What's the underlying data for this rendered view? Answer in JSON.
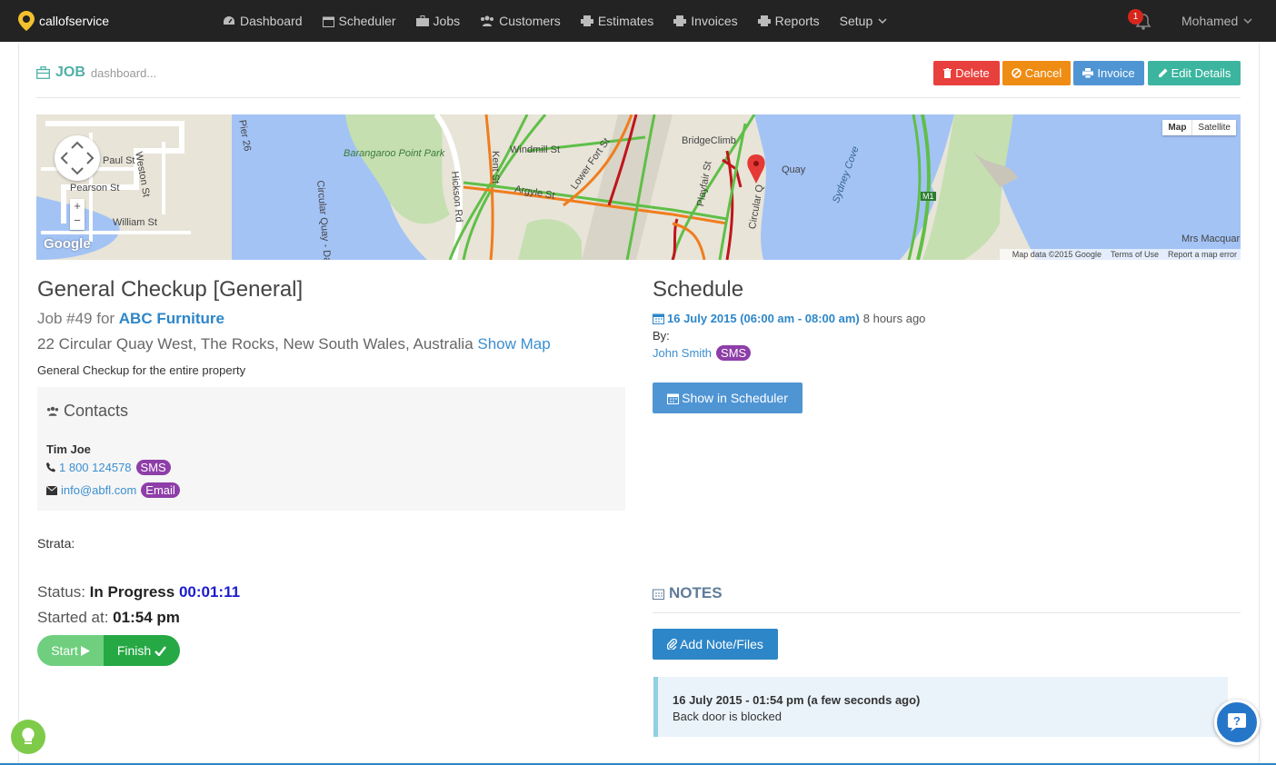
{
  "app": {
    "logo_text": "callofservice"
  },
  "nav": {
    "items": [
      {
        "label": "Dashboard",
        "icon": "dashboard-icon"
      },
      {
        "label": "Scheduler",
        "icon": "calendar-icon"
      },
      {
        "label": "Jobs",
        "icon": "briefcase-icon"
      },
      {
        "label": "Customers",
        "icon": "users-icon"
      },
      {
        "label": "Estimates",
        "icon": "print-icon"
      },
      {
        "label": "Invoices",
        "icon": "print-icon"
      },
      {
        "label": "Reports",
        "icon": "print-icon"
      },
      {
        "label": "Setup",
        "icon": "chevron-down-icon"
      }
    ],
    "notification_count": "1",
    "user_name": "Mohamed"
  },
  "header": {
    "title": "JOB",
    "subtitle": "dashboard..."
  },
  "actions": {
    "delete": "Delete",
    "cancel": "Cancel",
    "invoice": "Invoice",
    "edit": "Edit Details"
  },
  "map": {
    "type_map": "Map",
    "type_satellite": "Satellite",
    "attribution": "Map data ©2015 Google",
    "terms": "Terms of Use",
    "report": "Report a map error",
    "google": "Google",
    "labels": {
      "paul_st": "Paul St",
      "pearson_st": "Pearson St",
      "william_st": "William St",
      "weston_st": "Weston St",
      "pier": "Pier 26",
      "barangaroo": "Barangaroo Point Park",
      "windmill": "Windmill St",
      "argyle": "Argyle St",
      "lower_fort": "Lower Fort St",
      "bridgeclimb": "BridgeClimb",
      "quay": "Quay",
      "sydney_cove": "Sydney Cove",
      "mrs_macquar": "Mrs Macquar",
      "m1": "M1",
      "circular_quay": "Circular Quay - Dar",
      "hickson": "Hickson Rd",
      "kent": "Kent St",
      "playfair": "Playfair St",
      "circular_q": "Circular Q"
    }
  },
  "job": {
    "title": "General Checkup [General]",
    "number_prefix": "Job #49 for ",
    "customer": "ABC Furniture",
    "address": "22 Circular Quay West, The Rocks, New South Wales, Australia",
    "show_map": "Show Map",
    "description": "General Checkup for the entire property"
  },
  "contacts": {
    "title": "Contacts",
    "name": "Tim Joe",
    "phone": "1 800 124578",
    "sms": "SMS",
    "email": "info@abfl.com",
    "email_badge": "Email"
  },
  "strata": {
    "label": "Strata:"
  },
  "status": {
    "label": "Status:",
    "value": "In Progress",
    "timer": "00:01:11",
    "started_label": "Started at:",
    "started_value": "01:54 pm",
    "start_btn": "Start",
    "finish_btn": "Finish"
  },
  "schedule": {
    "title": "Schedule",
    "date": "16 July 2015 (06:00 am - 08:00 am)",
    "ago": "8 hours ago",
    "by_label": "By:",
    "by_name": "John Smith",
    "sms": "SMS",
    "show_btn": "Show in Scheduler"
  },
  "notes": {
    "title": "NOTES",
    "add_btn": "Add Note/Files",
    "items": [
      {
        "head": "16 July 2015 - 01:54 pm (a few seconds ago)",
        "body": "Back door is blocked"
      }
    ]
  },
  "colors": {
    "nav_bg": "#232323",
    "delete": "#e8403c",
    "cancel": "#ef8c14",
    "invoice": "#4f95d4",
    "edit": "#3bb59f",
    "badge": "#8e3ea8",
    "finish": "#26a844",
    "start": "#6fcf7f"
  }
}
